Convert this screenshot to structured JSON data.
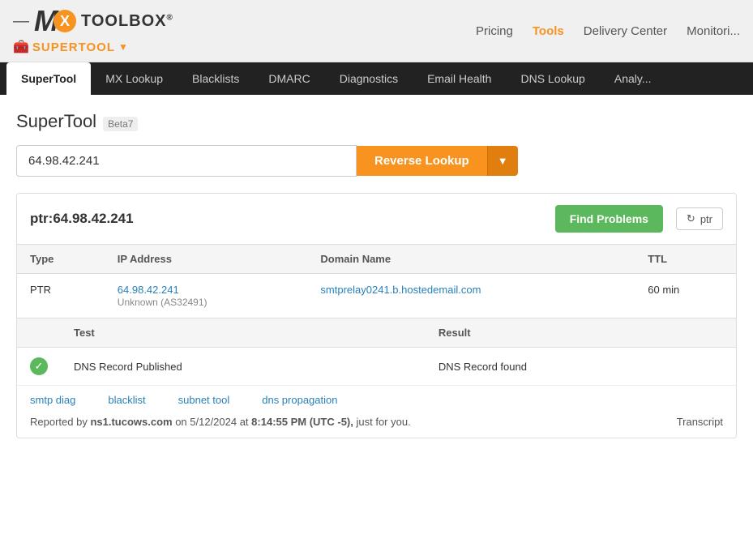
{
  "header": {
    "logo_m": "M",
    "logo_x": "X",
    "logo_toolbox": "TOOLBOX",
    "logo_reg": "®",
    "supertool_label": "SUPERTOOL",
    "nav": {
      "pricing": "Pricing",
      "tools": "Tools",
      "delivery_center": "Delivery Center",
      "monitoring": "Monitori..."
    }
  },
  "tabs": [
    {
      "id": "supertool",
      "label": "SuperTool",
      "active": true
    },
    {
      "id": "mx-lookup",
      "label": "MX Lookup",
      "active": false
    },
    {
      "id": "blacklists",
      "label": "Blacklists",
      "active": false
    },
    {
      "id": "dmarc",
      "label": "DMARC",
      "active": false
    },
    {
      "id": "diagnostics",
      "label": "Diagnostics",
      "active": false
    },
    {
      "id": "email-health",
      "label": "Email Health",
      "active": false
    },
    {
      "id": "dns-lookup",
      "label": "DNS Lookup",
      "active": false
    },
    {
      "id": "analyze",
      "label": "Analy...",
      "active": false
    }
  ],
  "page": {
    "title": "SuperTool",
    "beta_label": "Beta7",
    "search_value": "64.98.42.241",
    "lookup_button": "Reverse Lookup"
  },
  "ptr_section": {
    "title": "ptr:64.98.42.241",
    "find_problems_btn": "Find Problems",
    "ptr_badge_label": "ptr",
    "table": {
      "headers": [
        "Type",
        "IP Address",
        "Domain Name",
        "TTL"
      ],
      "rows": [
        {
          "type": "PTR",
          "ip": "64.98.42.241",
          "ip_info": "Unknown (AS32491)",
          "domain": "smtprelay0241.b.hostedemail.com",
          "ttl": "60 min"
        }
      ]
    },
    "test_table": {
      "headers": [
        "",
        "Test",
        "Result"
      ],
      "rows": [
        {
          "status": "pass",
          "test": "DNS Record Published",
          "result": "DNS Record found"
        }
      ]
    }
  },
  "footer": {
    "links": [
      "smtp diag",
      "blacklist",
      "subnet tool",
      "dns propagation"
    ],
    "report_text": "Reported by",
    "ns": "ns1.tucows.com",
    "on_text": "on 5/12/2024 at",
    "time": "8:14:55 PM (UTC -5),",
    "just_for_you": "just for you",
    "period": ".",
    "transcript": "Transcript"
  }
}
